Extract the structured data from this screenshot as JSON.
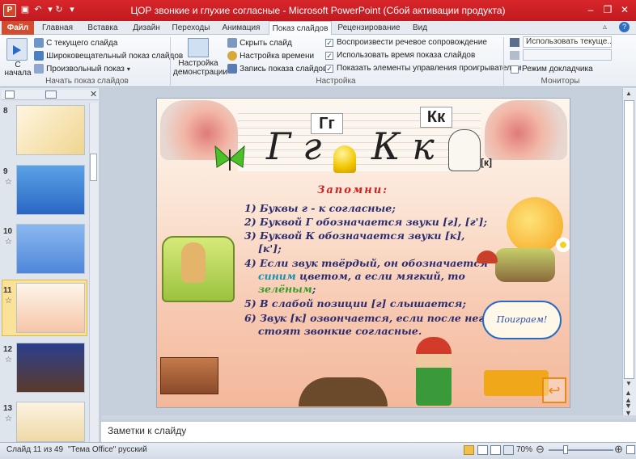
{
  "window": {
    "title": "ЦОР звонкие и глухие согласные  -  Microsoft PowerPoint (Сбой активации продукта)",
    "app_icon": "P"
  },
  "tabs": [
    "Файл",
    "Главная",
    "Вставка",
    "Дизайн",
    "Переходы",
    "Анимация",
    "Показ слайдов",
    "Рецензирование",
    "Вид"
  ],
  "ribbon": {
    "start_group": {
      "label": "Начать показ слайдов",
      "from_start": "С начала",
      "from_current": "С текущего слайда",
      "broadcast": "Широковещательный показ слайдов",
      "custom": "Произвольный показ"
    },
    "setup_group": {
      "label": "Настройка",
      "setup_show": "Настройка демонстрации",
      "hide_slide": "Скрыть слайд",
      "rehearse": "Настройка времени",
      "record": "Запись показа слайдов",
      "play_narrations": "Воспроизвести речевое сопровождение",
      "use_timings": "Использовать время показа слайдов",
      "show_controls": "Показать элементы управления проигрывателем"
    },
    "monitors_group": {
      "label": "Мониторы",
      "use_current": "Использовать текуще...",
      "presenter_view": "Режим докладчика"
    }
  },
  "thumbnails": [
    {
      "num": "8"
    },
    {
      "num": "9"
    },
    {
      "num": "10"
    },
    {
      "num": "11"
    },
    {
      "num": "12"
    },
    {
      "num": "13"
    }
  ],
  "slide": {
    "big_letters_g": "Г г",
    "big_letters_k": "К к",
    "card_g": "Гг",
    "card_k": "Кк",
    "transcription": "[к]",
    "heading": "Запомни:",
    "lines": [
      "1)  Буквы г - к согласные;",
      "2)  Буквой Г обозначается звуки [г], [г'];",
      "3)  Буквой  К   обозначается   звуки   [к],",
      "[к'];",
      "4)  Если звук твёрдый, он обозначается",
      "синим",
      " цветом,  а  если  мягкий,  то",
      "зелёным",
      ";",
      "5)  В слабой позиции [г] слышается;",
      "6)   Звук   [к]  озвончается,  если после него",
      "стоят звонкие согласные."
    ],
    "cloud_text": "Поиграем!"
  },
  "notes_placeholder": "Заметки к слайду",
  "status": {
    "slide_counter": "Слайд 11 из 49",
    "theme": "\"Тема Office\"",
    "language": "русский",
    "zoom": "70%"
  },
  "colors": {
    "accent": "#c01a1f",
    "blue_word": "#1a8fb0",
    "green_word": "#3a9a2a"
  }
}
